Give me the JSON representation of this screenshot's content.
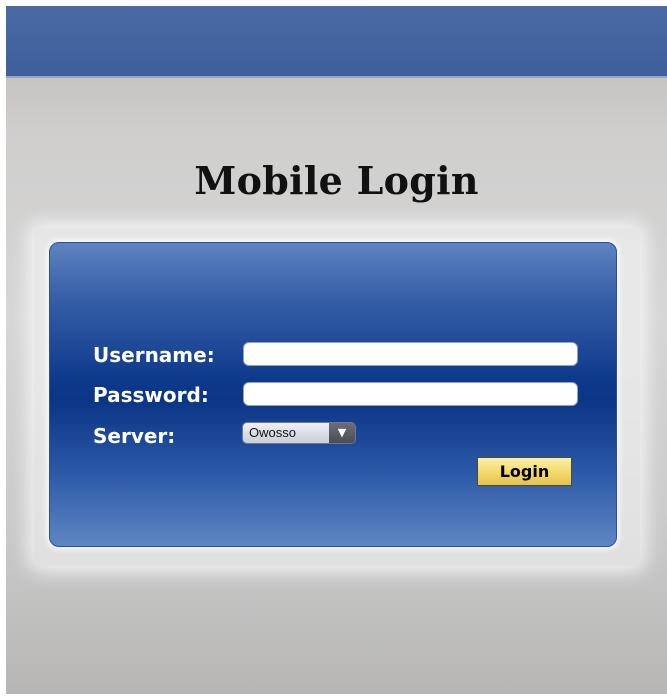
{
  "page": {
    "title": "Mobile Login"
  },
  "form": {
    "username_label": "Username:",
    "username_value": "",
    "password_label": "Password:",
    "password_value": "",
    "server_label": "Server:",
    "server_selected": "Owosso",
    "login_button": "Login"
  },
  "colors": {
    "topbar": "#3e5f9c",
    "panel": "#0e3a8c",
    "button": "#f2d86a"
  },
  "icons": {
    "dropdown": "chevron-down-icon"
  }
}
